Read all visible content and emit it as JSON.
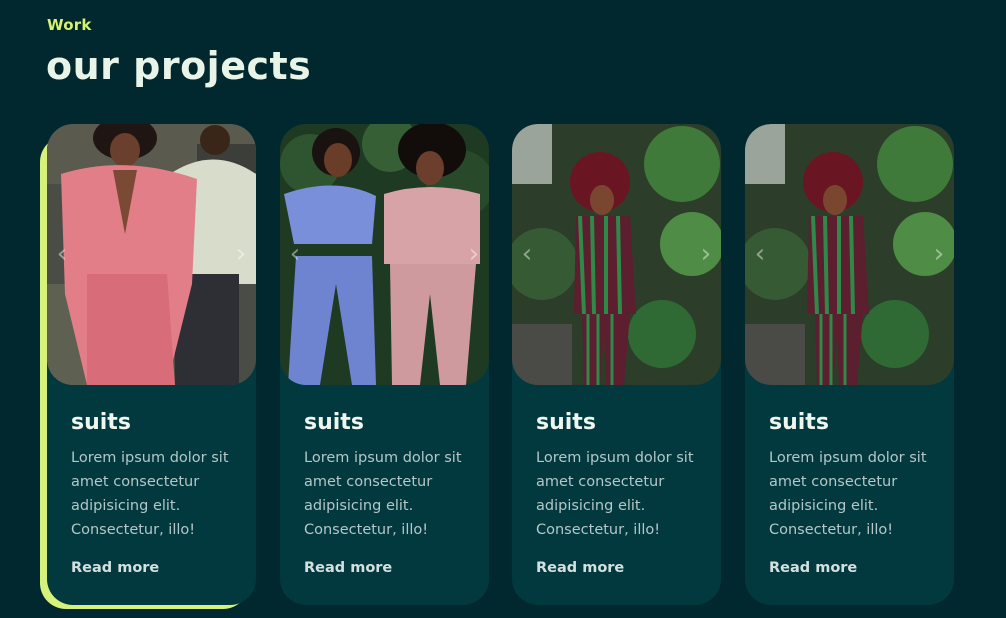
{
  "section": {
    "eyebrow": "Work",
    "title": "our projects"
  },
  "cards": [
    {
      "title": "suits",
      "text": "Lorem ipsum dolor sit amet consectetur adipisicing elit. Consectetur, illo!",
      "link": "Read more",
      "photo": "two-people-pink-suit-and-green-sweater"
    },
    {
      "title": "suits",
      "text": "Lorem ipsum dolor sit amet consectetur adipisicing elit. Consectetur, illo!",
      "link": "Read more",
      "photo": "two-women-blue-and-pink-outfits"
    },
    {
      "title": "suits",
      "text": "Lorem ipsum dolor sit amet consectetur adipisicing elit. Consectetur, illo!",
      "link": "Read more",
      "photo": "woman-striped-suit-among-plants"
    },
    {
      "title": "suits",
      "text": "Lorem ipsum dolor sit amet consectetur adipisicing elit. Consectetur, illo!",
      "link": "Read more",
      "photo": "woman-striped-suit-among-plants"
    }
  ],
  "colors": {
    "background": "#01282f",
    "card": "#01393f",
    "accent": "#d7f27a"
  }
}
